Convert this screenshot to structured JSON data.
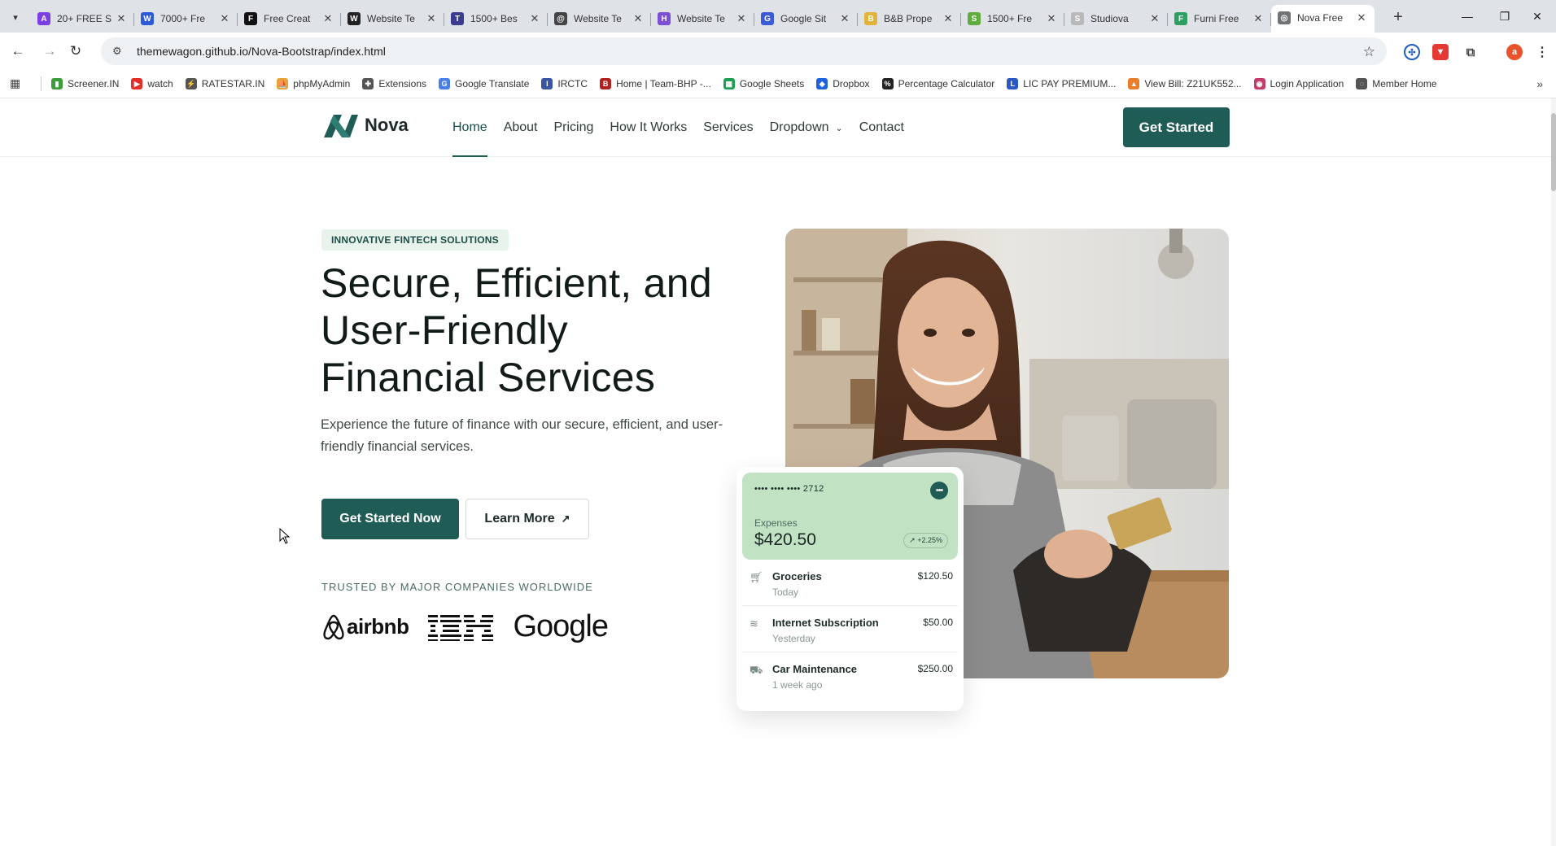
{
  "browser": {
    "tabs": [
      {
        "title": "20+ FREE S",
        "fav_color": "#7b3fe4",
        "fav_glyph": "A"
      },
      {
        "title": "7000+ Fre",
        "fav_color": "#2b5bd7",
        "fav_glyph": "W"
      },
      {
        "title": "Free Creat",
        "fav_color": "#111111",
        "fav_glyph": "F"
      },
      {
        "title": "Website Te",
        "fav_color": "#222222",
        "fav_glyph": "W"
      },
      {
        "title": "1500+ Bes",
        "fav_color": "#3b3b8f",
        "fav_glyph": "T"
      },
      {
        "title": "Website Te",
        "fav_color": "#444444",
        "fav_glyph": "@"
      },
      {
        "title": "Website Te",
        "fav_color": "#7a4fd6",
        "fav_glyph": "H"
      },
      {
        "title": "Google Sit",
        "fav_color": "#3b5bd8",
        "fav_glyph": "G"
      },
      {
        "title": "B&B Prope",
        "fav_color": "#e2b33b",
        "fav_glyph": "B"
      },
      {
        "title": "1500+ Fre",
        "fav_color": "#5fae3d",
        "fav_glyph": "S"
      },
      {
        "title": "Studiova",
        "fav_color": "#b9b9b9",
        "fav_glyph": "S"
      },
      {
        "title": "Furni Free",
        "fav_color": "#2f9e63",
        "fav_glyph": "F"
      },
      {
        "title": "Nova Free",
        "fav_color": "#6f7375",
        "fav_glyph": "◎",
        "active": true
      }
    ],
    "new_tab_label": "+",
    "address": "themewagon.github.io/Nova-Bootstrap/index.html",
    "profile_initial": "a",
    "bookmarks": [
      {
        "label": "Screener.IN",
        "color": "#3a9c3a",
        "glyph": "▮"
      },
      {
        "label": "watch",
        "color": "#e52d27",
        "glyph": "▶"
      },
      {
        "label": "RATESTAR.IN",
        "color": "#555555",
        "glyph": "⚡"
      },
      {
        "label": "phpMyAdmin",
        "color": "#e8a23b",
        "glyph": "⛵"
      },
      {
        "label": "Extensions",
        "color": "#555555",
        "glyph": "✚"
      },
      {
        "label": "Google Translate",
        "color": "#4a7fe8",
        "glyph": "G"
      },
      {
        "label": "IRCTC",
        "color": "#3a55a0",
        "glyph": "I"
      },
      {
        "label": "Home | Team-BHP -...",
        "color": "#b02222",
        "glyph": "B"
      },
      {
        "label": "Google Sheets",
        "color": "#1e9e52",
        "glyph": "▦"
      },
      {
        "label": "Dropbox",
        "color": "#1f62e0",
        "glyph": "◆"
      },
      {
        "label": "Percentage Calculator",
        "color": "#222222",
        "glyph": "%"
      },
      {
        "label": "LIC PAY PREMIUM...",
        "color": "#2b59c3",
        "glyph": "L"
      },
      {
        "label": "View Bill: Z21UK552...",
        "color": "#e87d2b",
        "glyph": "▲"
      },
      {
        "label": "Login Application",
        "color": "#c73b6a",
        "glyph": "◉"
      },
      {
        "label": "Member Home",
        "color": "#555555",
        "glyph": "◌"
      }
    ]
  },
  "site": {
    "brand": "Nova",
    "nav": [
      "Home",
      "About",
      "Pricing",
      "How It Works",
      "Services",
      "Dropdown",
      "Contact"
    ],
    "header_cta": "Get Started",
    "colors": {
      "primary": "#1f5c55",
      "badge_bg": "#e8f3ec",
      "card_green": "#c2e3c3"
    }
  },
  "hero": {
    "badge": "INNOVATIVE FINTECH SOLUTIONS",
    "title": "Secure, Efficient, and User-Friendly Financial Services",
    "subtitle": "Experience the future of finance with our secure, efficient, and user-friendly financial services.",
    "primary_button": "Get Started Now",
    "secondary_button": "Learn More",
    "trusted_label": "TRUSTED BY MAJOR COMPANIES WORLDWIDE",
    "partner_logos": [
      "airbnb",
      "IBM",
      "Google"
    ]
  },
  "expense_card": {
    "card_number": "•••• •••• ••••  2712",
    "label": "Expenses",
    "amount": "$420.50",
    "trend": "+2.25%",
    "transactions": [
      {
        "name": "Groceries",
        "when": "Today",
        "amount": "$120.50",
        "icon": "cart-icon"
      },
      {
        "name": "Internet Subscription",
        "when": "Yesterday",
        "amount": "$50.00",
        "icon": "wifi-icon"
      },
      {
        "name": "Car Maintenance",
        "when": "1 week ago",
        "amount": "$250.00",
        "icon": "car-icon"
      }
    ]
  }
}
